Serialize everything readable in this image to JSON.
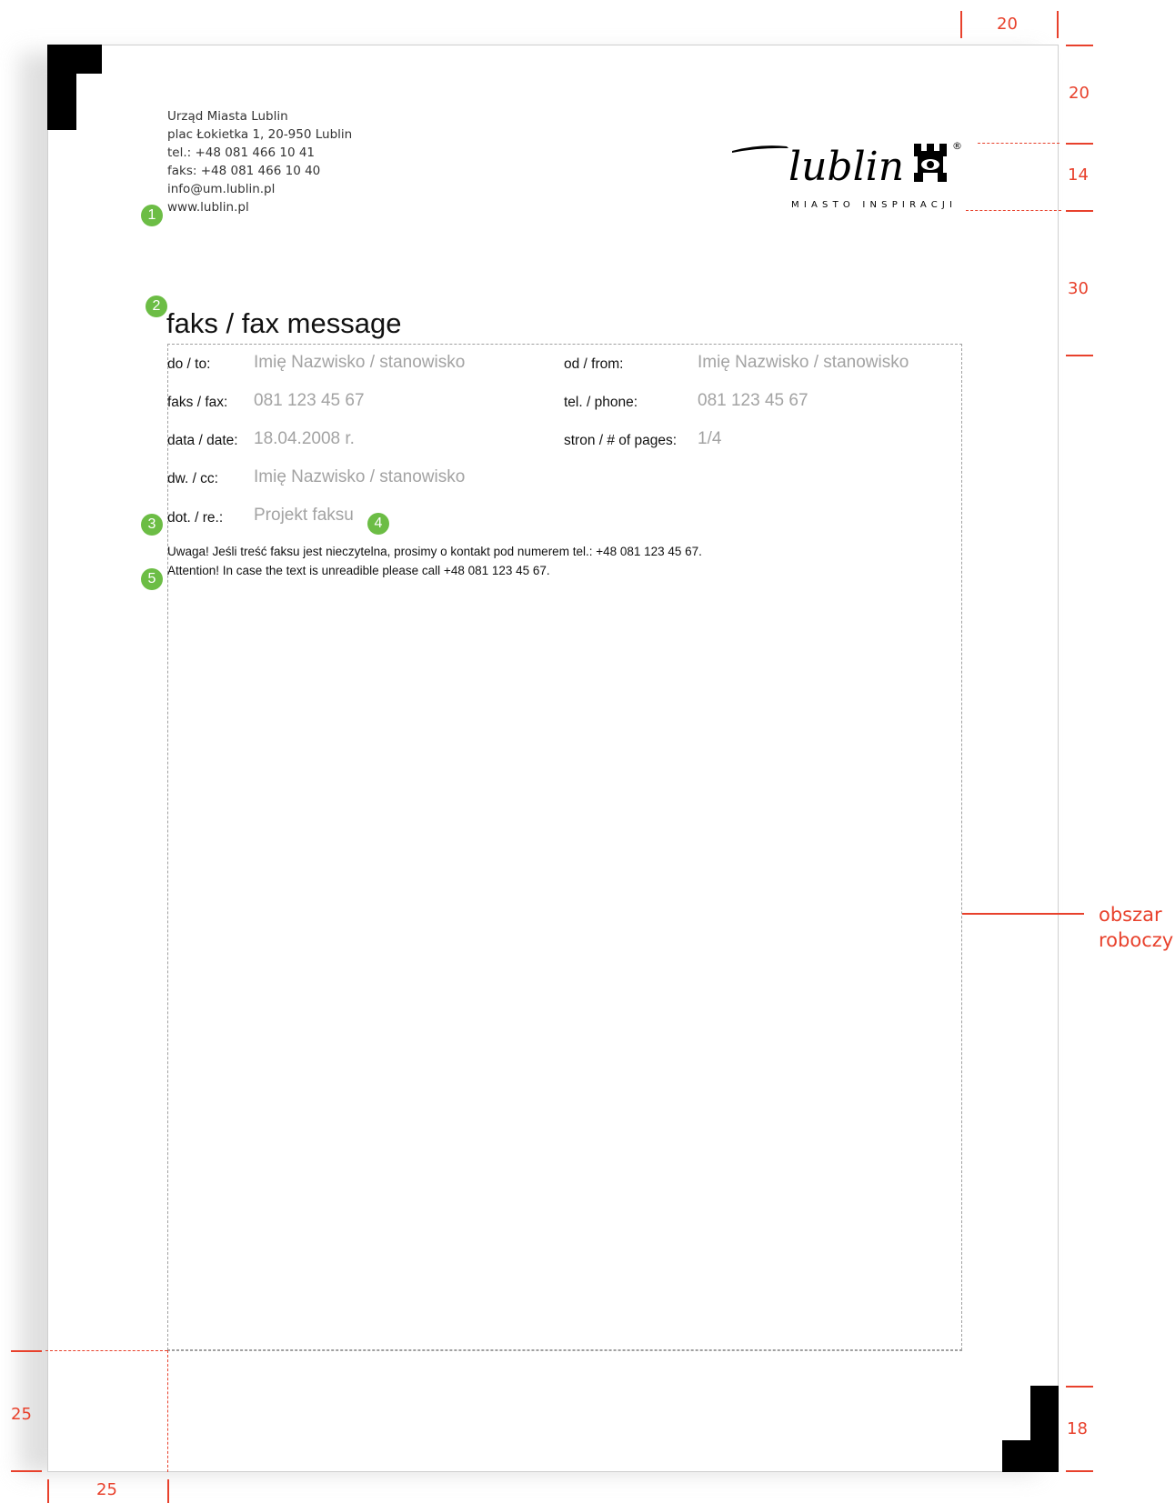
{
  "letterhead": {
    "address_lines": [
      "Urząd Miasta Lublin",
      "plac Łokietka 1, 20-950 Lublin",
      "tel.: +48 081 466 10 41",
      "faks: +48 081 466 10 40",
      "info@um.lublin.pl",
      "www.lublin.pl"
    ]
  },
  "logo": {
    "wordmark": "lublin",
    "tagline": "MIASTO INSPIRACJI",
    "registered": "®"
  },
  "title": "faks / fax message",
  "fields": {
    "to_label": "do / to:",
    "to_value": "Imię Nazwisko / stanowisko",
    "from_label": "od / from:",
    "from_value": "Imię Nazwisko / stanowisko",
    "fax_label": "faks / fax:",
    "fax_value": "081 123 45 67",
    "phone_label": "tel. / phone:",
    "phone_value": "081 123 45 67",
    "date_label": "data / date:",
    "date_value": "18.04.2008 r.",
    "pages_label": "stron / # of pages:",
    "pages_value": "1/4",
    "cc_label": "dw. / cc:",
    "cc_value": "Imię Nazwisko / stanowisko",
    "re_label": "dot. / re.:",
    "re_value": "Projekt faksu"
  },
  "notice": {
    "polish": "Uwaga! Jeśli treść faksu jest nieczytelna, prosimy o kontakt pod numerem tel.: +48 081 123 45 67.",
    "english": "Attention! In case the text is unreadible please call +48 081 123 45 67."
  },
  "markers": [
    "1",
    "2",
    "3",
    "4",
    "5"
  ],
  "dimensions": {
    "top_right": "20",
    "right_top": "20",
    "logo_height": "14",
    "logo_gap": "30",
    "working_area": "obszar\nroboczy",
    "bottom_left": "25",
    "left_bottom": "25",
    "bottom_right": "18"
  },
  "colors": {
    "annotation": "#e8412c",
    "marker": "#6cbd45",
    "placeholder_text": "#a3a3a3"
  }
}
